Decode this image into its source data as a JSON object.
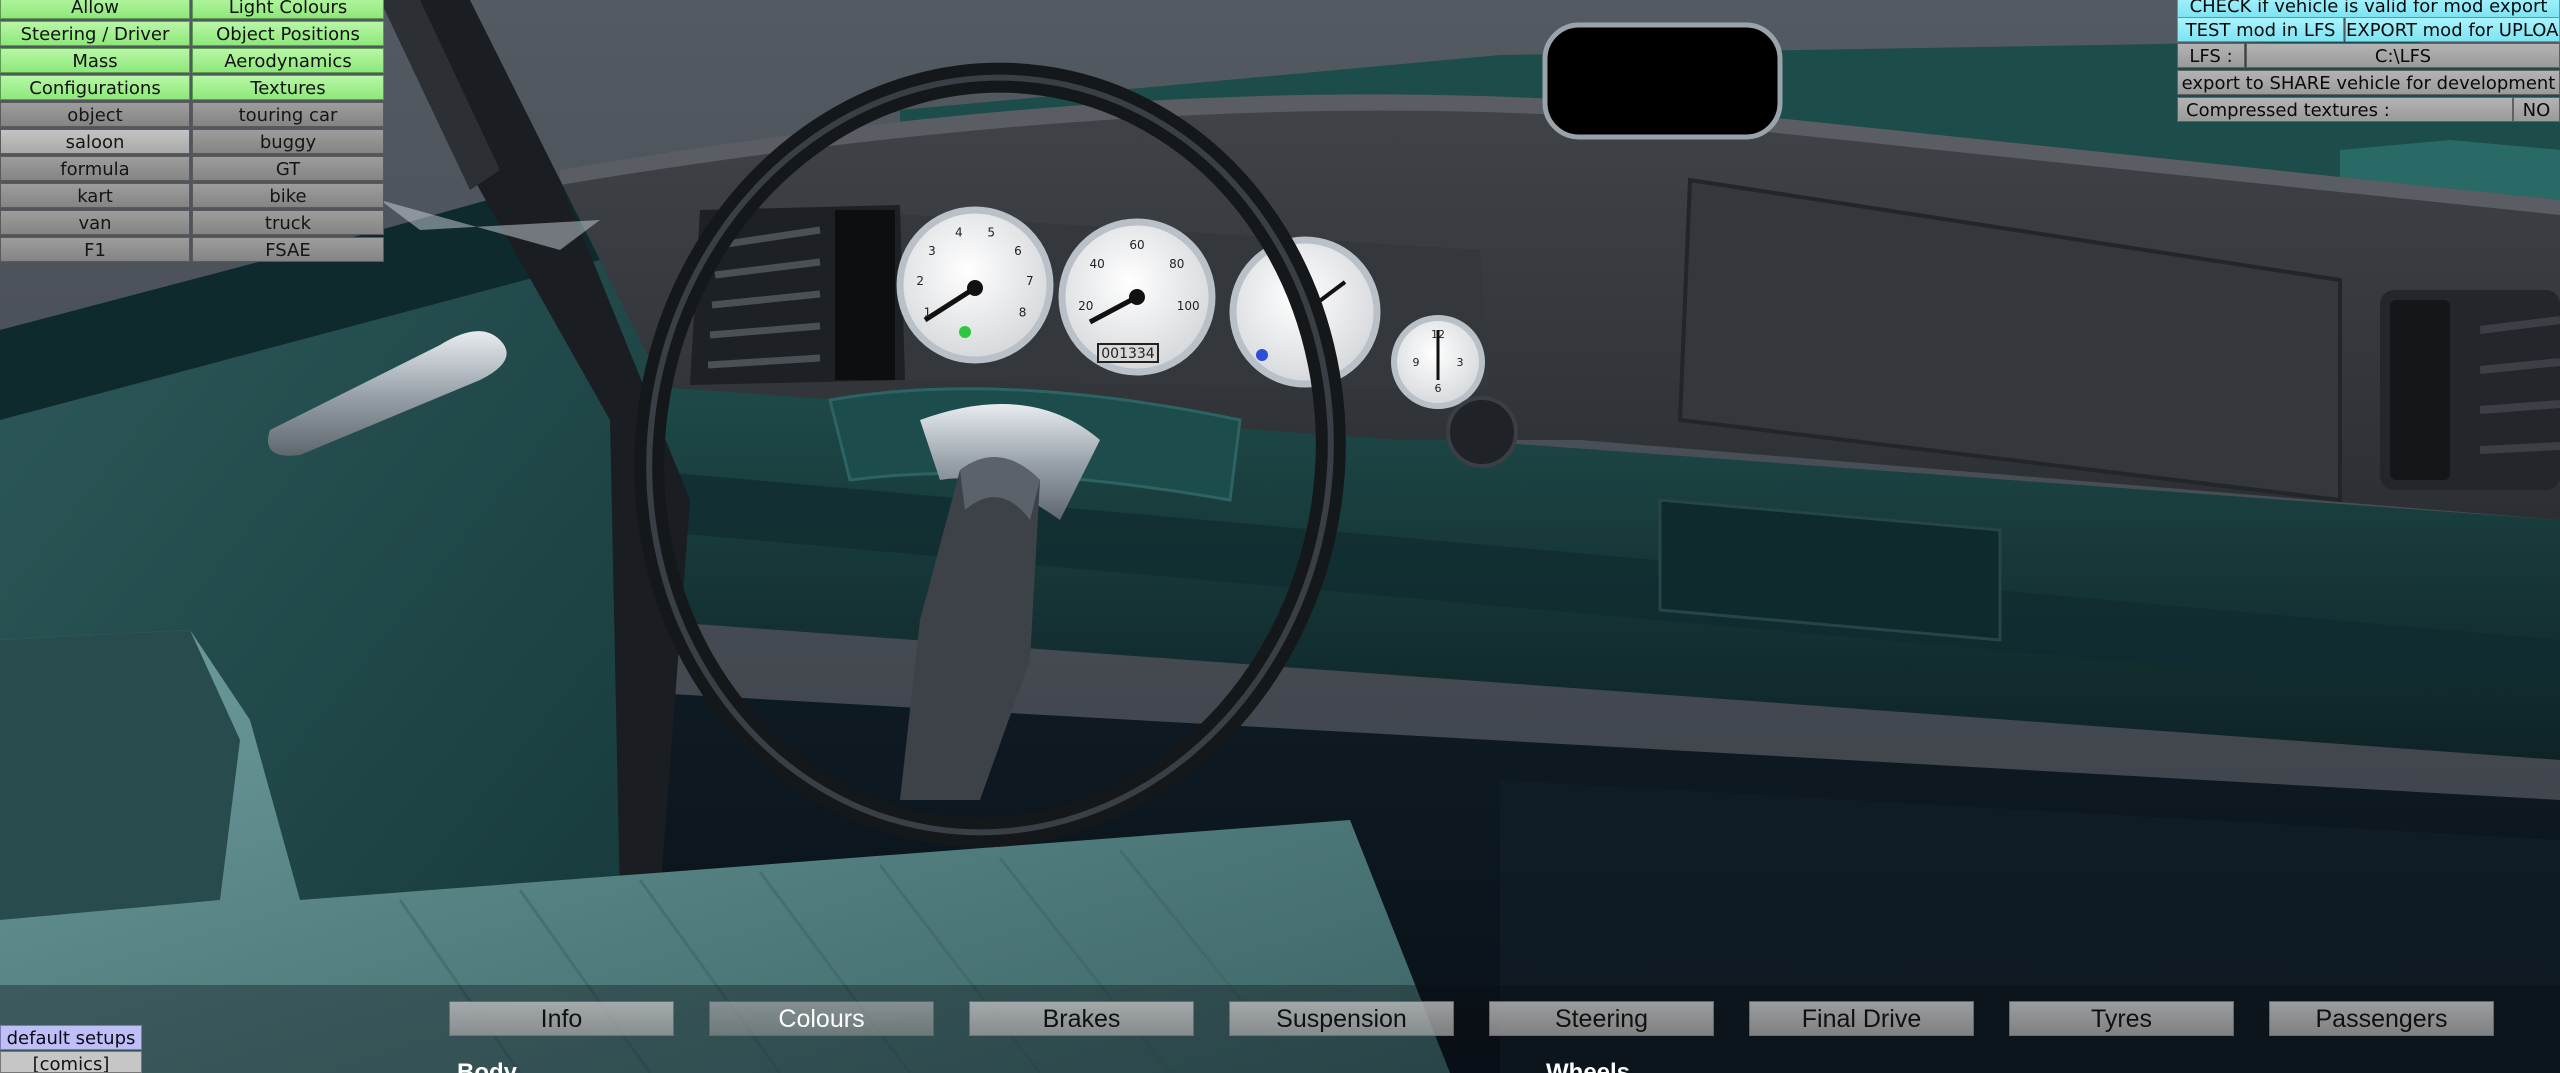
{
  "left_panel": {
    "rows": [
      [
        "Allow",
        "Light Colours"
      ],
      [
        "Steering / Driver",
        "Object Positions"
      ],
      [
        "Mass",
        "Aerodynamics"
      ],
      [
        "Configurations",
        "Textures"
      ],
      [
        "object",
        "touring car"
      ],
      [
        "saloon",
        "buggy"
      ],
      [
        "formula",
        "GT"
      ],
      [
        "kart",
        "bike"
      ],
      [
        "van",
        "truck"
      ],
      [
        "F1",
        "FSAE"
      ]
    ],
    "selected": "saloon"
  },
  "right_panel": {
    "check_label": "CHECK if vehicle is valid for mod export",
    "test_label": "TEST mod in LFS",
    "export_label": "EXPORT mod for UPLOAD",
    "lfs_label": "LFS :",
    "lfs_path": "C:\\LFS",
    "share_label": "export to SHARE vehicle for development",
    "compressed_label": "Compressed textures :",
    "compressed_value": "NO"
  },
  "tabs": [
    "Info",
    "Colours",
    "Brakes",
    "Suspension",
    "Steering",
    "Final Drive",
    "Tyres",
    "Passengers"
  ],
  "active_tab": "Colours",
  "sections": {
    "body": "Body",
    "wheels": "Wheels"
  },
  "bottom_left": {
    "setups": "default setups",
    "comics": "[comics]"
  },
  "gauges": {
    "odometer": "001334",
    "speedo_ticks": [
      "20",
      "40",
      "60",
      "80",
      "100"
    ],
    "tach_ticks": [
      "1",
      "2",
      "3",
      "4",
      "5",
      "6",
      "7",
      "8"
    ],
    "clock_ticks": [
      "12",
      "3",
      "6",
      "9"
    ]
  },
  "colors": {
    "green_button": "#9cee88",
    "cyan_button": "#8ee9f6",
    "grey_button": "#929292",
    "setups_button": "#bfbff7",
    "dashboard": "#3a3d42",
    "car_paint": "#1e4e4c",
    "seat": "#4f7c7d"
  }
}
